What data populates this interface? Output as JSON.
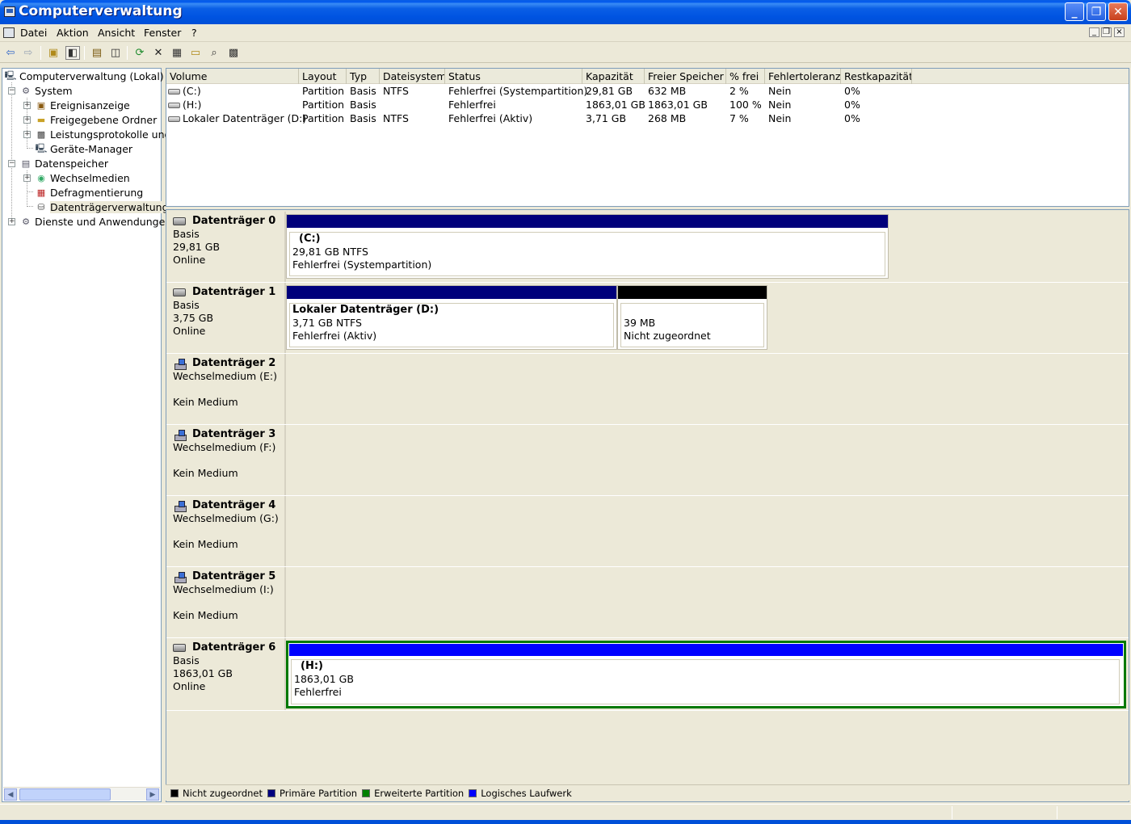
{
  "window": {
    "title": "Computerverwaltung",
    "minimize_glyph": "_",
    "restore_glyph": "❐",
    "close_glyph": "✕"
  },
  "menu": {
    "items": [
      "Datei",
      "Aktion",
      "Ansicht",
      "Fenster",
      "?"
    ]
  },
  "toolbar": {
    "icons": [
      "back-icon",
      "forward-icon",
      "up-folder-icon",
      "show-hide-tree-icon",
      "properties-icon",
      "help-icon",
      "refresh-icon",
      "delete-icon",
      "new-icon",
      "open-folder-icon",
      "search-icon",
      "settings-icon"
    ]
  },
  "tree": {
    "items": [
      {
        "label": "Computerverwaltung (Lokal)",
        "icon": "computer-icon"
      },
      {
        "label": "System",
        "icon": "tools-icon"
      },
      {
        "label": "Ereignisanzeige",
        "icon": "event-viewer-icon"
      },
      {
        "label": "Freigegebene Ordner",
        "icon": "shared-folder-icon"
      },
      {
        "label": "Leistungsprotokolle und",
        "icon": "performance-icon"
      },
      {
        "label": "Geräte-Manager",
        "icon": "device-manager-icon"
      },
      {
        "label": "Datenspeicher",
        "icon": "storage-icon"
      },
      {
        "label": "Wechselmedien",
        "icon": "removable-media-icon"
      },
      {
        "label": "Defragmentierung",
        "icon": "defrag-icon"
      },
      {
        "label": "Datenträgerverwaltung",
        "icon": "disk-management-icon",
        "selected": true
      },
      {
        "label": "Dienste und Anwendungen",
        "icon": "services-icon"
      }
    ]
  },
  "volumes": {
    "columns": [
      "Volume",
      "Layout",
      "Typ",
      "Dateisystem",
      "Status",
      "Kapazität",
      "Freier Speicher",
      "% frei",
      "Fehlertoleranz",
      "Restkapazität"
    ],
    "rows": [
      [
        "(C:)",
        "Partition",
        "Basis",
        "NTFS",
        "Fehlerfrei (Systempartition)",
        "29,81 GB",
        "632 MB",
        "2 %",
        "Nein",
        "0%"
      ],
      [
        "(H:)",
        "Partition",
        "Basis",
        "",
        "Fehlerfrei",
        "1863,01 GB",
        "1863,01 GB",
        "100 %",
        "Nein",
        "0%"
      ],
      [
        "Lokaler Datenträger (D:)",
        "Partition",
        "Basis",
        "NTFS",
        "Fehlerfrei (Aktiv)",
        "3,71 GB",
        "268 MB",
        "7 %",
        "Nein",
        "0%"
      ]
    ]
  },
  "disks": [
    {
      "name": "Datenträger 0",
      "line1": "Basis",
      "line2": "29,81 GB",
      "line3": "Online",
      "parts": [
        {
          "name": "(C:)",
          "l1": "29,81 GB NTFS",
          "l2": "Fehlerfrei (Systempartition)"
        }
      ]
    },
    {
      "name": "Datenträger 1",
      "line1": "Basis",
      "line2": "3,75 GB",
      "line3": "Online",
      "parts": [
        {
          "name": "Lokaler Datenträger  (D:)",
          "l1": "3,71 GB NTFS",
          "l2": "Fehlerfrei (Aktiv)"
        },
        {
          "name": "",
          "l1": "39 MB",
          "l2": "Nicht zugeordnet"
        }
      ]
    },
    {
      "name": "Datenträger 2",
      "line1": "Wechselmedium (E:)",
      "line2": "",
      "line3": "Kein Medium"
    },
    {
      "name": "Datenträger 3",
      "line1": "Wechselmedium (F:)",
      "line2": "",
      "line3": "Kein Medium"
    },
    {
      "name": "Datenträger 4",
      "line1": "Wechselmedium (G:)",
      "line2": "",
      "line3": "Kein Medium"
    },
    {
      "name": "Datenträger 5",
      "line1": "Wechselmedium (I:)",
      "line2": "",
      "line3": "Kein Medium"
    },
    {
      "name": "Datenträger 6",
      "line1": "Basis",
      "line2": "1863,01 GB",
      "line3": "Online",
      "parts": [
        {
          "name": "(H:)",
          "l1": "1863,01 GB",
          "l2": "Fehlerfrei"
        }
      ]
    }
  ],
  "legend": [
    {
      "label": "Nicht zugeordnet",
      "color": "#000000"
    },
    {
      "label": "Primäre Partition",
      "color": "#000080"
    },
    {
      "label": "Erweiterte Partition",
      "color": "#008000"
    },
    {
      "label": "Logisches Laufwerk",
      "color": "#0000ff"
    }
  ],
  "colors": {
    "primary_partition": "#00007b",
    "unallocated": "#000000",
    "logical_drive": "#0000ff",
    "extended_partition": "#008000",
    "titlebar": "#0054e3"
  }
}
